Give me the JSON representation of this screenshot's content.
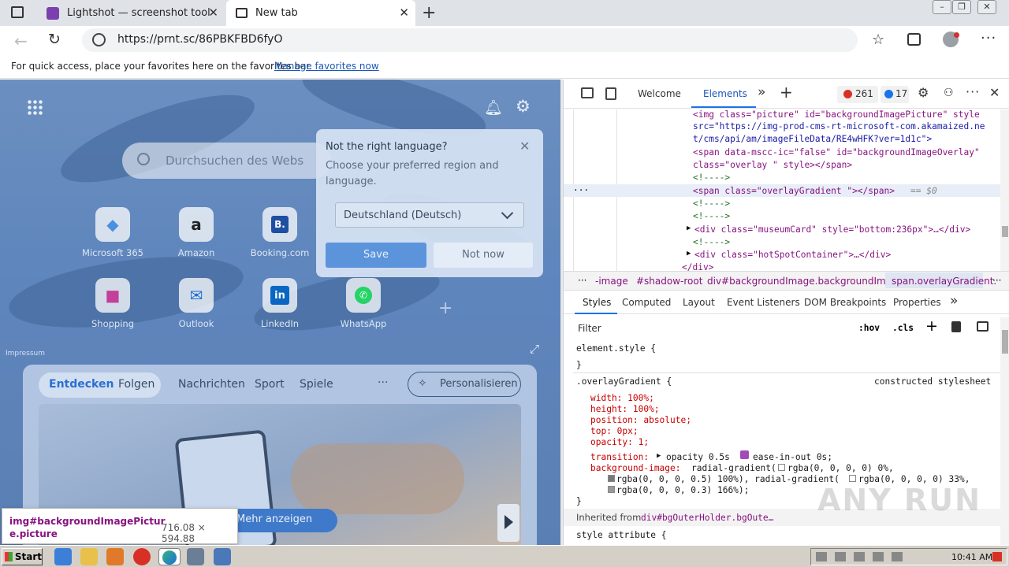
{
  "tabs": [
    {
      "title": "Lightshot — screenshot tool for M"
    },
    {
      "title": "New tab"
    }
  ],
  "address": {
    "url": "https://prnt.sc/86PBKFBD6fyO"
  },
  "favorites_bar": {
    "text": "For quick access, place your favorites here on the favorites bar.",
    "link": "Manage favorites now"
  },
  "ntp": {
    "search_placeholder": "Durchsuchen des Webs",
    "tiles": [
      "Microsoft 365",
      "Amazon",
      "Booking.com",
      "Shopping",
      "Outlook",
      "LinkedIn",
      "WhatsApp"
    ],
    "impressum": "Impressum",
    "language_popup": {
      "title": "Not the right language?",
      "body": "Choose your preferred region and language.",
      "selected": "Deutschland (Deutsch)",
      "save": "Save",
      "not_now": "Not now"
    },
    "feed_tabs": [
      "Entdecken",
      "Folgen",
      "Nachrichten",
      "Sport",
      "Spiele"
    ],
    "more": "···",
    "personalize": "Personalisieren",
    "mehr_anzeigen": "Mehr anzeigen"
  },
  "devtools": {
    "tabs": [
      "Welcome",
      "Elements"
    ],
    "errors": "261",
    "warnings": "17",
    "breadcrumbs": [
      "-image",
      "#shadow-root",
      "div#backgroundImage.backgroundImage",
      "span.overlayGradient."
    ],
    "subtabs": [
      "Styles",
      "Computed",
      "Layout",
      "Event Listeners",
      "DOM Breakpoints",
      "Properties"
    ],
    "filter_placeholder": "Filter",
    "hov": ":hov",
    "cls": ".cls",
    "element_style": "element.style {",
    "rule_selector": ".overlayGradient {",
    "rule_source": "constructed stylesheet",
    "inherited": "Inherited from",
    "inherited_from": "div#bgOuterHolder.bgOute…",
    "style_attribute": "style attribute {",
    "dom_marker": "== $0",
    "lines": {
      "l1a": "<img class=\"picture\" id=\"backgroundImagePicture\" style",
      "l1b": "src=\"https://img-prod-cms-rt-microsoft-com.akamaized.ne",
      "l1c": "t/cms/api/am/imageFileData/RE4wHFK?ver=1d1c\">",
      "l2a": "<span data-mscc-ic=\"false\" id=\"backgroundImageOverlay\"",
      "l2b": "class=\"overlay  \" style></span>",
      "l3": "<!---->",
      "l4": "<span class=\"overlayGradient \"></span>",
      "l5": "<!---->",
      "l6": "<!---->",
      "l7": "<div class=\"museumCard\" style=\"bottom:236px\">…</div>",
      "l8": "<!---->",
      "l9": "<div class=\"hotSpotContainer\">…</div>",
      "l10": "</div>"
    },
    "styles": {
      "width": "width: 100%;",
      "height": "height: 100%;",
      "position": "position: absolute;",
      "top": "top: 0px;",
      "opacity": "opacity: 1;",
      "transition_label": "transition:",
      "transition_value": "opacity 0.5s",
      "transition_tail": "ease-in-out 0s;",
      "bg_label": "background-image:",
      "bg_1": "radial-gradient(",
      "bg_1b": "rgba(0, 0, 0, 0) 0%,",
      "bg_2": "rgba(0, 0, 0, 0.5) 100%), radial-gradient(",
      "bg_2b": "rgba(0, 0, 0, 0) 33%,",
      "bg_3": "rgba(0, 0, 0, 0.3) 166%);",
      "close": "}"
    }
  },
  "tooltip": {
    "selector": "img#backgroundImagePictur e.picture",
    "size": "716.08 × 594.88"
  },
  "taskbar": {
    "start": "Start",
    "clock": "10:41 AM"
  },
  "watermark": "ANY RUN"
}
